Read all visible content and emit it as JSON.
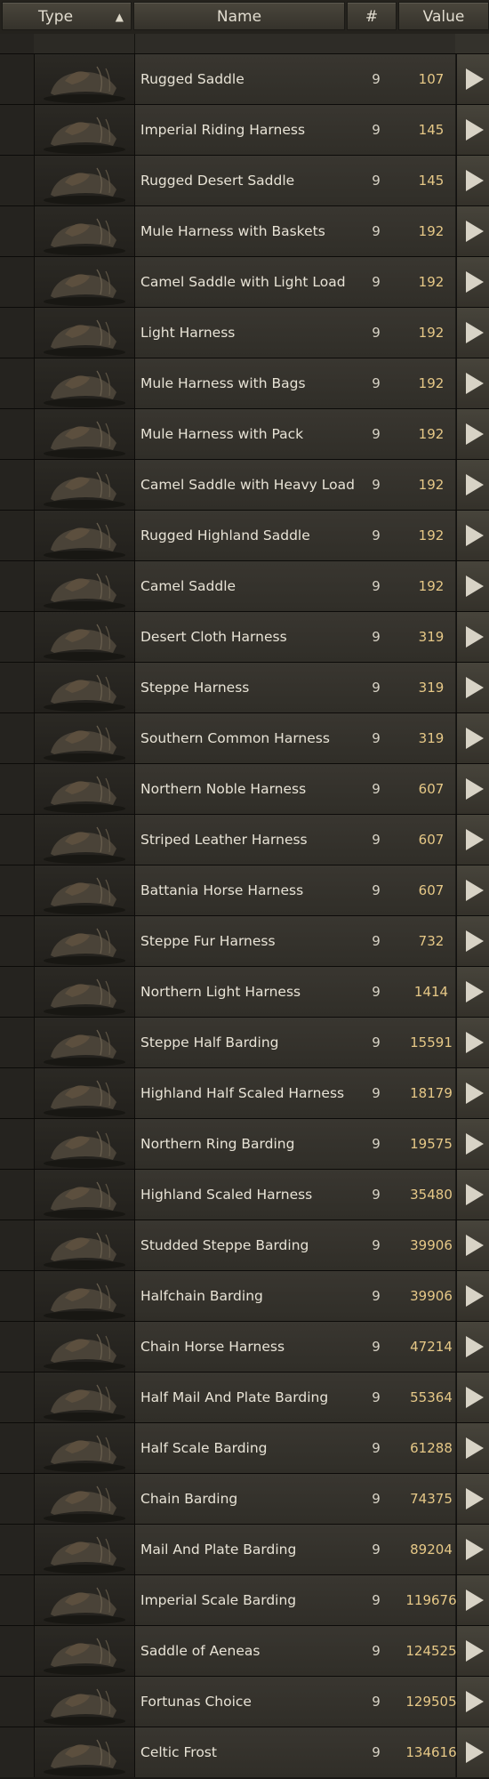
{
  "header": {
    "type_label": "Type",
    "name_label": "Name",
    "count_label": "#",
    "value_label": "Value",
    "sort_icon": "triangle-up"
  },
  "colors": {
    "value_text": "#e6c887",
    "name_text": "#e8e3d6",
    "row_bg": "#35322c"
  },
  "items": [
    {
      "name": "Rugged Saddle",
      "count": "9",
      "value": "107"
    },
    {
      "name": "Imperial Riding Harness",
      "count": "9",
      "value": "145"
    },
    {
      "name": "Rugged Desert Saddle",
      "count": "9",
      "value": "145"
    },
    {
      "name": "Mule Harness with Baskets",
      "count": "9",
      "value": "192"
    },
    {
      "name": "Camel Saddle with Light Load",
      "count": "9",
      "value": "192"
    },
    {
      "name": "Light Harness",
      "count": "9",
      "value": "192"
    },
    {
      "name": "Mule Harness with Bags",
      "count": "9",
      "value": "192"
    },
    {
      "name": "Mule Harness with Pack",
      "count": "9",
      "value": "192"
    },
    {
      "name": "Camel Saddle with Heavy Load",
      "count": "9",
      "value": "192"
    },
    {
      "name": "Rugged Highland Saddle",
      "count": "9",
      "value": "192"
    },
    {
      "name": "Camel Saddle",
      "count": "9",
      "value": "192"
    },
    {
      "name": "Desert Cloth Harness",
      "count": "9",
      "value": "319"
    },
    {
      "name": "Steppe Harness",
      "count": "9",
      "value": "319"
    },
    {
      "name": "Southern Common Harness",
      "count": "9",
      "value": "319"
    },
    {
      "name": "Northern Noble Harness",
      "count": "9",
      "value": "607"
    },
    {
      "name": "Striped Leather Harness",
      "count": "9",
      "value": "607"
    },
    {
      "name": "Battania Horse Harness",
      "count": "9",
      "value": "607"
    },
    {
      "name": "Steppe Fur Harness",
      "count": "9",
      "value": "732"
    },
    {
      "name": "Northern Light Harness",
      "count": "9",
      "value": "1414"
    },
    {
      "name": "Steppe Half Barding",
      "count": "9",
      "value": "15591"
    },
    {
      "name": "Highland Half Scaled Harness",
      "count": "9",
      "value": "18179"
    },
    {
      "name": "Northern Ring Barding",
      "count": "9",
      "value": "19575"
    },
    {
      "name": "Highland Scaled Harness",
      "count": "9",
      "value": "35480"
    },
    {
      "name": "Studded Steppe Barding",
      "count": "9",
      "value": "39906"
    },
    {
      "name": "Halfchain Barding",
      "count": "9",
      "value": "39906"
    },
    {
      "name": "Chain Horse Harness",
      "count": "9",
      "value": "47214"
    },
    {
      "name": "Half Mail And Plate Barding",
      "count": "9",
      "value": "55364"
    },
    {
      "name": "Half Scale Barding",
      "count": "9",
      "value": "61288"
    },
    {
      "name": "Chain Barding",
      "count": "9",
      "value": "74375"
    },
    {
      "name": "Mail And Plate Barding",
      "count": "9",
      "value": "89204"
    },
    {
      "name": "Imperial Scale Barding",
      "count": "9",
      "value": "119676"
    },
    {
      "name": "Saddle of Aeneas",
      "count": "9",
      "value": "124525"
    },
    {
      "name": "Fortunas Choice",
      "count": "9",
      "value": "129505"
    },
    {
      "name": "Celtic Frost",
      "count": "9",
      "value": "134616"
    }
  ]
}
